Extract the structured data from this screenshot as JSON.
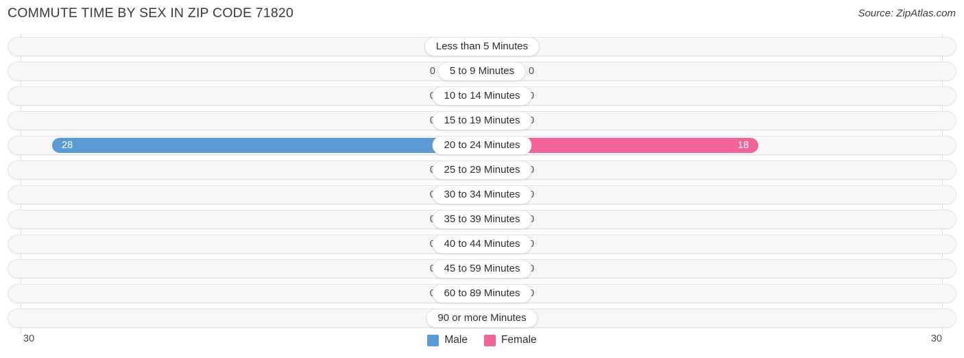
{
  "header": {
    "title": "COMMUTE TIME BY SEX IN ZIP CODE 71820",
    "source": "Source: ZipAtlas.com"
  },
  "legend": {
    "male_label": "Male",
    "female_label": "Female",
    "male_color": "#5b9bd5",
    "female_color": "#f2649a"
  },
  "axis": {
    "left_max": "30",
    "right_max": "30"
  },
  "chart_data": {
    "type": "bar",
    "subtype": "diverging-horizontal",
    "title": "COMMUTE TIME BY SEX IN ZIP CODE 71820",
    "xlabel": "",
    "ylabel": "",
    "xlim": [
      30,
      30
    ],
    "axis_note": "Counts diverge from centre; both axis ends labelled 30",
    "grid": true,
    "legend_position": "bottom-center",
    "categories": [
      "Less than 5 Minutes",
      "5 to 9 Minutes",
      "10 to 14 Minutes",
      "15 to 19 Minutes",
      "20 to 24 Minutes",
      "25 to 29 Minutes",
      "30 to 34 Minutes",
      "35 to 39 Minutes",
      "40 to 44 Minutes",
      "45 to 59 Minutes",
      "60 to 89 Minutes",
      "90 or more Minutes"
    ],
    "series": [
      {
        "name": "Male",
        "values": [
          0,
          0,
          0,
          0,
          28,
          0,
          0,
          0,
          0,
          0,
          0,
          0
        ]
      },
      {
        "name": "Female",
        "values": [
          0,
          0,
          0,
          0,
          18,
          0,
          0,
          0,
          0,
          0,
          0,
          0
        ]
      }
    ]
  },
  "rows": [
    {
      "label": "Less than 5 Minutes",
      "male": "0",
      "female": "0",
      "male_pct": 0,
      "female_pct": 0,
      "highlight": false
    },
    {
      "label": "5 to 9 Minutes",
      "male": "0",
      "female": "0",
      "male_pct": 0,
      "female_pct": 0,
      "highlight": false
    },
    {
      "label": "10 to 14 Minutes",
      "male": "0",
      "female": "0",
      "male_pct": 0,
      "female_pct": 0,
      "highlight": false
    },
    {
      "label": "15 to 19 Minutes",
      "male": "0",
      "female": "0",
      "male_pct": 0,
      "female_pct": 0,
      "highlight": false
    },
    {
      "label": "20 to 24 Minutes",
      "male": "28",
      "female": "18",
      "male_pct": 93.3,
      "female_pct": 60.0,
      "highlight": true
    },
    {
      "label": "25 to 29 Minutes",
      "male": "0",
      "female": "0",
      "male_pct": 0,
      "female_pct": 0,
      "highlight": false
    },
    {
      "label": "30 to 34 Minutes",
      "male": "0",
      "female": "0",
      "male_pct": 0,
      "female_pct": 0,
      "highlight": false
    },
    {
      "label": "35 to 39 Minutes",
      "male": "0",
      "female": "0",
      "male_pct": 0,
      "female_pct": 0,
      "highlight": false
    },
    {
      "label": "40 to 44 Minutes",
      "male": "0",
      "female": "0",
      "male_pct": 0,
      "female_pct": 0,
      "highlight": false
    },
    {
      "label": "45 to 59 Minutes",
      "male": "0",
      "female": "0",
      "male_pct": 0,
      "female_pct": 0,
      "highlight": false
    },
    {
      "label": "60 to 89 Minutes",
      "male": "0",
      "female": "0",
      "male_pct": 0,
      "female_pct": 0,
      "highlight": false
    },
    {
      "label": "90 or more Minutes",
      "male": "0",
      "female": "0",
      "male_pct": 0,
      "female_pct": 0,
      "highlight": false
    }
  ]
}
